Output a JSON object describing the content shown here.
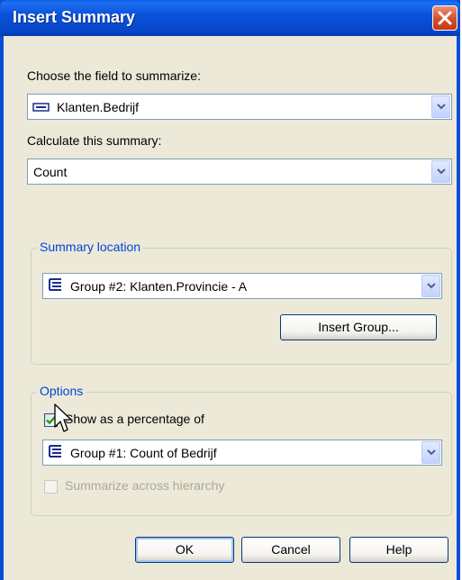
{
  "dialog": {
    "title": "Insert Summary"
  },
  "field": {
    "label": "Choose the field to summarize:",
    "value": "Klanten.Bedrijf"
  },
  "calc": {
    "label": "Calculate this summary:",
    "value": "Count"
  },
  "location": {
    "group_title": "Summary location",
    "value": "Group #2: Klanten.Provincie - A",
    "insert_group_label": "Insert Group..."
  },
  "options": {
    "group_title": "Options",
    "show_percentage_label": "Show as a percentage of",
    "show_percentage_checked": true,
    "percentage_of_value": "Group #1: Count of Bedrijf",
    "summarize_hierarchy_label": "Summarize across hierarchy",
    "summarize_hierarchy_enabled": false
  },
  "buttons": {
    "ok": "OK",
    "cancel": "Cancel",
    "help": "Help"
  },
  "colors": {
    "titlebar": "#0a52db",
    "face": "#ece9d8",
    "group_title": "#0046d5",
    "check_mark": "#21a121"
  }
}
